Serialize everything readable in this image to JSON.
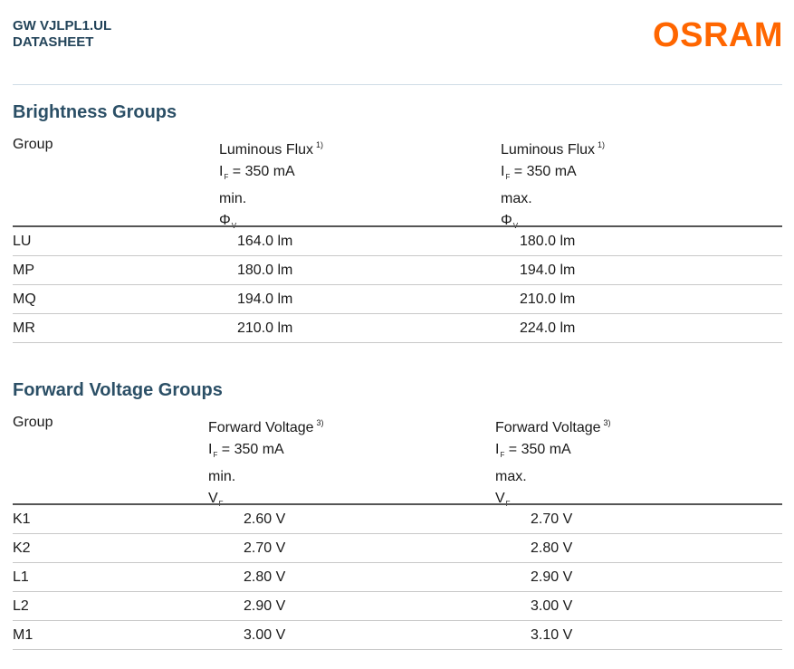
{
  "header": {
    "product": "GW VJLPL1.UL",
    "doc_type": "DATASHEET",
    "logo": "OSRAM",
    "logo_color": "#ff6600"
  },
  "brightness": {
    "title": "Brightness Groups",
    "headers": {
      "group": "Group",
      "min": {
        "name": "Luminous Flux",
        "note": "1)",
        "current_prefix": "I",
        "current_sub": "F",
        "current_value": "= 350 mA",
        "qualifier": "min.",
        "symbol": "Φ",
        "symbol_sub": "V"
      },
      "max": {
        "name": "Luminous Flux",
        "note": "1)",
        "current_prefix": "I",
        "current_sub": "F",
        "current_value": "= 350 mA",
        "qualifier": "max.",
        "symbol": "Φ",
        "symbol_sub": "V"
      }
    },
    "rows": [
      {
        "group": "LU",
        "min": "164.0 lm",
        "max": "180.0 lm"
      },
      {
        "group": "MP",
        "min": "180.0 lm",
        "max": "194.0 lm"
      },
      {
        "group": "MQ",
        "min": "194.0 lm",
        "max": "210.0 lm"
      },
      {
        "group": "MR",
        "min": "210.0 lm",
        "max": "224.0 lm"
      }
    ]
  },
  "voltage": {
    "title": "Forward Voltage Groups",
    "headers": {
      "group": "Group",
      "min": {
        "name": "Forward Voltage",
        "note": "3)",
        "current_prefix": "I",
        "current_sub": "F",
        "current_value": "= 350 mA",
        "qualifier": "min.",
        "symbol": "V",
        "symbol_sub": "F"
      },
      "max": {
        "name": "Forward Voltage",
        "note": "3)",
        "current_prefix": "I",
        "current_sub": "F",
        "current_value": "= 350 mA",
        "qualifier": "max.",
        "symbol": "V",
        "symbol_sub": "F"
      }
    },
    "rows": [
      {
        "group": "K1",
        "min": "2.60 V",
        "max": "2.70 V"
      },
      {
        "group": "K2",
        "min": "2.70 V",
        "max": "2.80 V"
      },
      {
        "group": "L1",
        "min": "2.80 V",
        "max": "2.90 V"
      },
      {
        "group": "L2",
        "min": "2.90 V",
        "max": "3.00 V"
      },
      {
        "group": "M1",
        "min": "3.00 V",
        "max": "3.10 V"
      }
    ]
  }
}
